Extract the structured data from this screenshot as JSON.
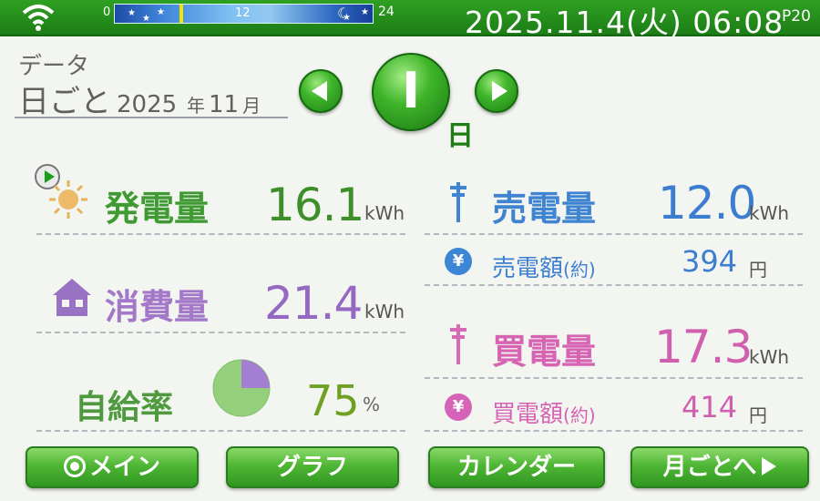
{
  "statusbar": {
    "datetime": "2025.11.4(火) 06:08",
    "page_indicator": "P20",
    "timeline": {
      "start": "0",
      "mid": "12",
      "end": "24",
      "current_hour": 6
    }
  },
  "header": {
    "mode_label": "データ",
    "period_label": "日ごと",
    "year": "2025",
    "year_suffix": "年",
    "month": "11",
    "month_suffix": "月",
    "day_button": "I",
    "day_unit": "日"
  },
  "generation": {
    "label": "発電量",
    "value": "16.1",
    "unit": "kWh"
  },
  "consumption": {
    "label": "消費量",
    "value": "21.4",
    "unit": "kWh"
  },
  "self_sufficiency": {
    "label": "自給率",
    "value": "75",
    "unit": "%",
    "percent": 75
  },
  "sell": {
    "label": "売電量",
    "value": "12.0",
    "unit": "kWh",
    "amount_label": "売電額",
    "amount_note": "(約)",
    "amount_value": "394",
    "amount_unit": "円"
  },
  "buy": {
    "label": "買電量",
    "value": "17.3",
    "unit": "kWh",
    "amount_label": "買電額",
    "amount_note": "(約)",
    "amount_value": "414",
    "amount_unit": "円"
  },
  "yen_symbol": "¥",
  "buttons": {
    "main": "メイン",
    "graph": "グラフ",
    "calendar": "カレンダー",
    "month": "月ごとへ"
  },
  "colors": {
    "accent_green": "#3fb52a",
    "generation": "#3e8e2c",
    "consumption": "#9469c2",
    "sell": "#3d7dd0",
    "buy": "#d05fae"
  }
}
